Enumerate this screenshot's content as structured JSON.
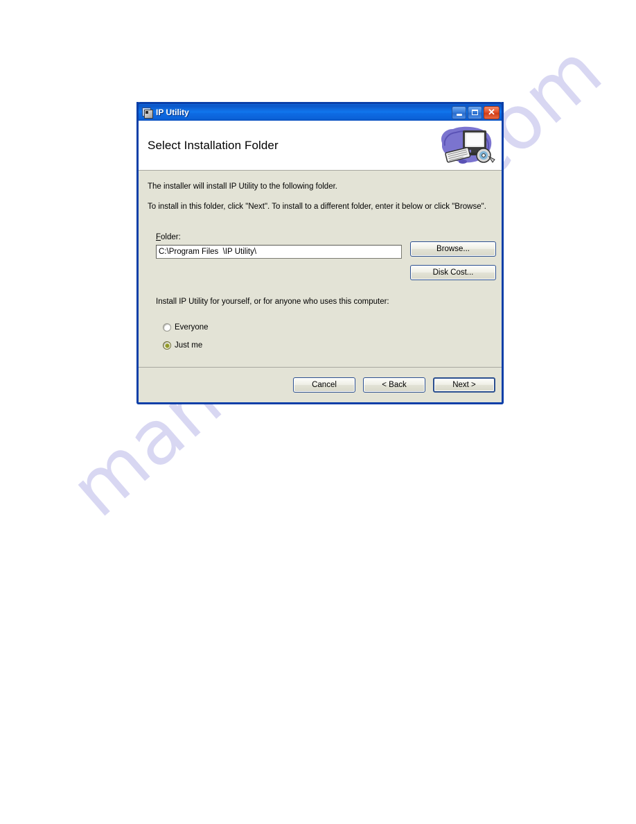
{
  "window": {
    "title": "IP Utility",
    "title_icon": "msi-package-icon",
    "controls": {
      "minimize": "minimize-icon",
      "maximize": "maximize-icon",
      "close": "close-icon"
    }
  },
  "header": {
    "title": "Select Installation Folder",
    "graphic": "computer-and-cd-icon"
  },
  "body": {
    "intro_line": "The installer will install IP Utility to the following folder.",
    "instruction_line": "To install in this folder, click \"Next\". To install to a different folder, enter it below or click \"Browse\".",
    "folder_label_accel": "F",
    "folder_label_rest": "older:",
    "folder_value": "C:\\Program Files  \\IP Utility\\",
    "folder_placeholder": "",
    "browse_button": "Browse...",
    "disk_cost_button": "Disk Cost...",
    "who_label": "Install IP Utility for yourself, or for anyone who uses this computer:",
    "radio_options": [
      {
        "label": "Everyone",
        "checked": false
      },
      {
        "label": "Just me",
        "checked": true
      }
    ]
  },
  "footer": {
    "cancel_button": "Cancel",
    "back_button": "< Back",
    "next_button": "Next >"
  },
  "watermark": {
    "text": "manualshive.com"
  },
  "colors": {
    "titlebar_blue": "#0a56c8",
    "window_border": "#0a3fa8",
    "body_beige": "#e3e3d6",
    "radio_selected": "#8f9629",
    "button_border": "#2b4f8e",
    "watermark": "#b9b7e8"
  }
}
